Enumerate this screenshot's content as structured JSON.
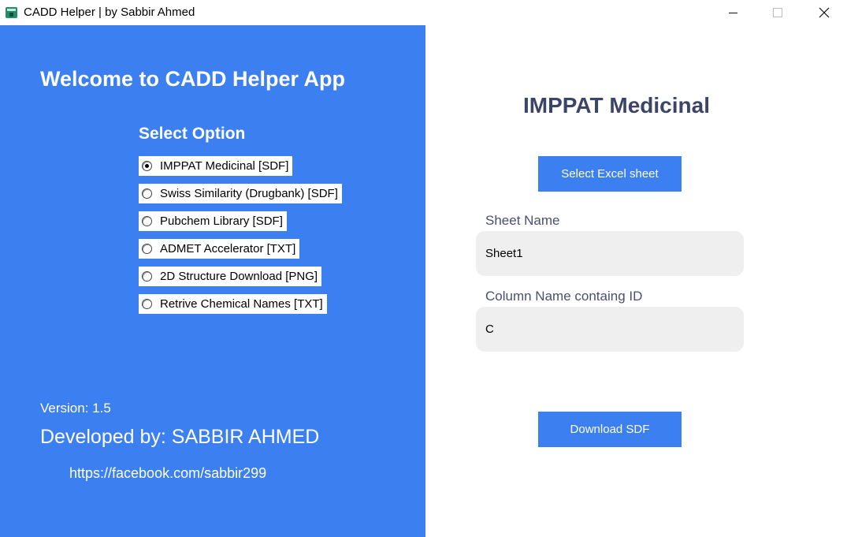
{
  "window": {
    "title": "CADD Helper | by Sabbir Ahmed"
  },
  "left_panel": {
    "welcome": "Welcome to CADD Helper App",
    "select_heading": "Select Option",
    "options": [
      {
        "label": "IMPPAT Medicinal [SDF]",
        "selected": true
      },
      {
        "label": "Swiss Similarity (Drugbank) [SDF]",
        "selected": false
      },
      {
        "label": "Pubchem Library [SDF]",
        "selected": false
      },
      {
        "label": "ADMET Accelerator [TXT]",
        "selected": false
      },
      {
        "label": "2D Structure Download [PNG]",
        "selected": false
      },
      {
        "label": "Retrive Chemical Names [TXT]",
        "selected": false
      }
    ],
    "version": "Version: 1.5",
    "developer": "Developed by: SABBIR AHMED",
    "link": "https://facebook.com/sabbir299"
  },
  "main": {
    "title": "IMPPAT Medicinal",
    "select_excel_label": "Select Excel sheet",
    "sheet_name_label": "Sheet Name",
    "sheet_name_value": "Sheet1",
    "column_name_label": "Column Name containg ID",
    "column_name_value": "C",
    "download_label": "Download SDF"
  },
  "colors": {
    "accent": "#3b7ff0",
    "title_text": "#3c4468",
    "field_background": "#efefef"
  }
}
